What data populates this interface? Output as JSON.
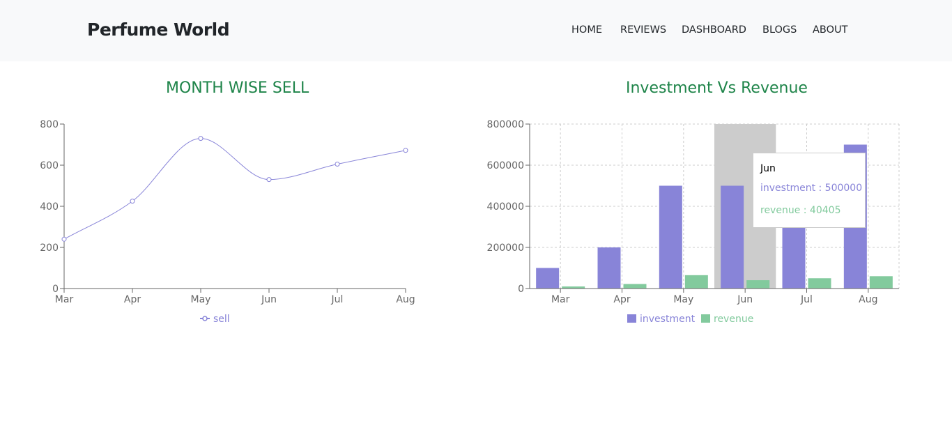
{
  "brand": "Perfume World",
  "nav": [
    "HOME",
    "REVIEWS",
    "DASHBOARD",
    "BLOGS",
    "ABOUT"
  ],
  "colors": {
    "line": "#8884d8",
    "investment": "#8884d8",
    "revenue": "#82ca9d",
    "title": "#1e8449",
    "highlight": "#cccccc"
  },
  "chart_data": [
    {
      "type": "line",
      "title": "MONTH WISE SELL",
      "categories": [
        "Mar",
        "Apr",
        "May",
        "Jun",
        "Jul",
        "Aug"
      ],
      "series": [
        {
          "name": "sell",
          "values": [
            240,
            425,
            730,
            530,
            605,
            672
          ]
        }
      ],
      "yticks": [
        "0",
        "200",
        "400",
        "600",
        "800"
      ],
      "ylim": [
        0,
        800
      ],
      "grid": false,
      "legend": "bottom"
    },
    {
      "type": "bar",
      "title": "Investment Vs Revenue",
      "categories": [
        "Mar",
        "Apr",
        "May",
        "Jun",
        "Jul",
        "Aug"
      ],
      "series": [
        {
          "name": "investment",
          "values": [
            100000,
            200000,
            500000,
            500000,
            400000,
            700000
          ]
        },
        {
          "name": "revenue",
          "values": [
            10000,
            22000,
            65000,
            40405,
            50000,
            60000
          ]
        }
      ],
      "yticks": [
        "0",
        "200000",
        "400000",
        "600000",
        "800000"
      ],
      "ylim": [
        0,
        800000
      ],
      "grid": true,
      "legend": "bottom",
      "tooltip": {
        "label": "Jun",
        "investment": "investment : 500000",
        "revenue": "revenue : 40405"
      }
    }
  ]
}
